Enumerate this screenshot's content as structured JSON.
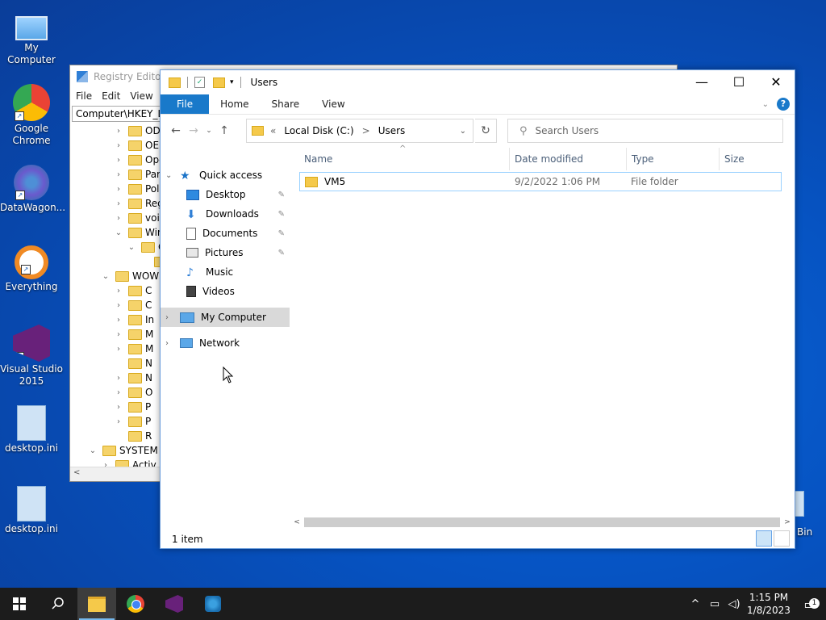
{
  "desktop": {
    "icons": [
      {
        "label": "My Computer",
        "icon": "computer-icon"
      },
      {
        "label": "Google Chrome",
        "icon": "chrome-icon"
      },
      {
        "label": "DataWagon...",
        "icon": "datawagon-icon"
      },
      {
        "label": "Everything",
        "icon": "everything-search-icon"
      },
      {
        "label": "Visual Studio 2015",
        "icon": "visual-studio-icon"
      },
      {
        "label": "desktop.ini",
        "icon": "ini-file-icon"
      },
      {
        "label": "desktop.ini",
        "icon": "ini-file-icon"
      }
    ],
    "recycle_bin_label": "Bin"
  },
  "registry": {
    "title": "Registry Editor",
    "menu": [
      "File",
      "Edit",
      "View"
    ],
    "address": "Computer\\HKEY_LOCAL_MACHINE",
    "tree": [
      {
        "label": "ODE",
        "depth": 2,
        "chev": ">"
      },
      {
        "label": "OEM",
        "depth": 2,
        "chev": ">"
      },
      {
        "label": "Ope",
        "depth": 2,
        "chev": ">"
      },
      {
        "label": "Part",
        "depth": 2,
        "chev": ">"
      },
      {
        "label": "Polic",
        "depth": 2,
        "chev": ">"
      },
      {
        "label": "Regi",
        "depth": 2,
        "chev": ">"
      },
      {
        "label": "void",
        "depth": 2,
        "chev": ">"
      },
      {
        "label": "Win",
        "depth": 2,
        "chev": "v"
      },
      {
        "label": "C",
        "depth": 3,
        "chev": "v"
      },
      {
        "label": "",
        "depth": 4,
        "chev": ""
      },
      {
        "label": "WOW",
        "depth": 1,
        "chev": "v"
      },
      {
        "label": "C",
        "depth": 2,
        "chev": ">"
      },
      {
        "label": "C",
        "depth": 2,
        "chev": ">"
      },
      {
        "label": "In",
        "depth": 2,
        "chev": ">"
      },
      {
        "label": "M",
        "depth": 2,
        "chev": ">"
      },
      {
        "label": "M",
        "depth": 2,
        "chev": ">"
      },
      {
        "label": "N",
        "depth": 2,
        "chev": ""
      },
      {
        "label": "N",
        "depth": 2,
        "chev": ">"
      },
      {
        "label": "O",
        "depth": 2,
        "chev": ">"
      },
      {
        "label": "P",
        "depth": 2,
        "chev": ">"
      },
      {
        "label": "P",
        "depth": 2,
        "chev": ">"
      },
      {
        "label": "R",
        "depth": 2,
        "chev": ""
      },
      {
        "label": "SYSTEM",
        "depth": 0,
        "chev": "v"
      },
      {
        "label": "Activ",
        "depth": 1,
        "chev": ">"
      }
    ]
  },
  "explorer": {
    "title": "Users",
    "ribbon_tabs": [
      "File",
      "Home",
      "Share",
      "View"
    ],
    "address": {
      "prefix": "«",
      "segments": [
        "Local Disk (C:)",
        ">",
        "Users"
      ]
    },
    "search_placeholder": "Search Users",
    "nav": [
      {
        "label": "Quick access",
        "icon": "star-icon",
        "chev": "v",
        "pinned": false,
        "indent": 0,
        "selected": false
      },
      {
        "label": "Desktop",
        "icon": "desktop-icon",
        "chev": "",
        "pinned": true,
        "indent": 1,
        "selected": false
      },
      {
        "label": "Downloads",
        "icon": "download-icon",
        "chev": "",
        "pinned": true,
        "indent": 1,
        "selected": false
      },
      {
        "label": "Documents",
        "icon": "documents-icon",
        "chev": "",
        "pinned": true,
        "indent": 1,
        "selected": false
      },
      {
        "label": "Pictures",
        "icon": "pictures-icon",
        "chev": "",
        "pinned": true,
        "indent": 1,
        "selected": false
      },
      {
        "label": "Music",
        "icon": "music-icon",
        "chev": "",
        "pinned": false,
        "indent": 1,
        "selected": false
      },
      {
        "label": "Videos",
        "icon": "videos-icon",
        "chev": "",
        "pinned": false,
        "indent": 1,
        "selected": false
      },
      {
        "label": "My Computer",
        "icon": "computer-icon",
        "chev": ">",
        "pinned": false,
        "indent": 0,
        "selected": true
      },
      {
        "label": "Network",
        "icon": "network-icon",
        "chev": ">",
        "pinned": false,
        "indent": 0,
        "selected": false
      }
    ],
    "columns": [
      "Name",
      "Date modified",
      "Type",
      "Size"
    ],
    "files": [
      {
        "name": "VM5",
        "date": "9/2/2022 1:06 PM",
        "type": "File folder",
        "size": ""
      }
    ],
    "status": "1 item"
  },
  "taskbar": {
    "items": [
      "start-icon",
      "search-icon",
      "file-explorer-icon",
      "chrome-icon",
      "visual-studio-icon",
      "datawagon-icon"
    ],
    "time": "1:15 PM",
    "date": "1/8/2023",
    "notification_count": "1"
  }
}
